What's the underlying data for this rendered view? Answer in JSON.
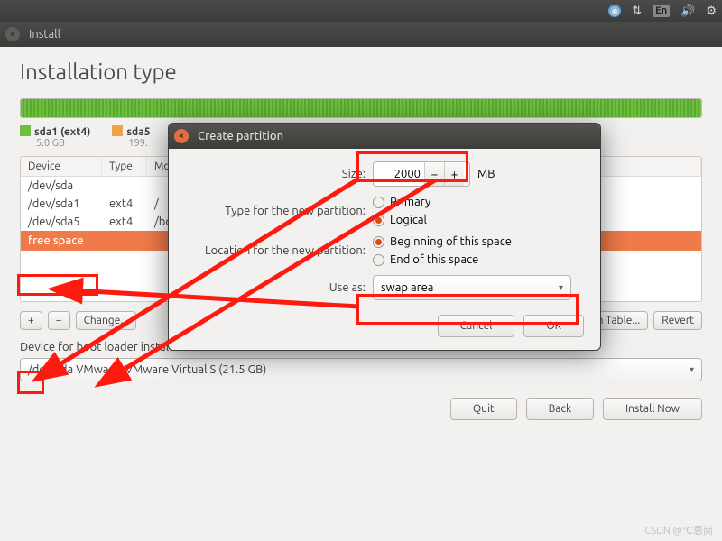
{
  "topbar": {
    "lang": "En"
  },
  "window": {
    "title": "Install",
    "heading": "Installation type",
    "legend": [
      {
        "label": "sda1 (ext4)",
        "size": "5.0 GB",
        "color": "#6fbf3f"
      },
      {
        "label": "sda5",
        "size": "199.",
        "color": "#f0a24a"
      }
    ],
    "columns": {
      "device": "Device",
      "type": "Type",
      "mount": "Mo"
    },
    "rows": [
      {
        "device": "/dev/sda",
        "type": "",
        "mount": ""
      },
      {
        "device": " /dev/sda1",
        "type": "ext4",
        "mount": "/"
      },
      {
        "device": " /dev/sda5",
        "type": "ext4",
        "mount": "/bo"
      },
      {
        "device": " free space",
        "type": "",
        "mount": "",
        "free": true
      }
    ],
    "toolbar": {
      "add": "+",
      "remove": "−",
      "change": "Change...",
      "newtable": "New Partition Table...",
      "revert": "Revert"
    },
    "boot_label": "Device for boot loader installation:",
    "boot_value": "/dev/sda   VMware, VMware Virtual S (21.5 GB)",
    "buttons": {
      "quit": "Quit",
      "back": "Back",
      "install": "Install Now"
    }
  },
  "dialog": {
    "title": "Create partition",
    "size_label": "Size:",
    "size_value": "2000",
    "size_unit": "MB",
    "type_label": "Type for the new partition:",
    "type_options": {
      "primary": "Primary",
      "logical": "Logical"
    },
    "type_selected": "logical",
    "loc_label": "Location for the new partition:",
    "loc_options": {
      "begin": "Beginning of this space",
      "end": "End of this space"
    },
    "loc_selected": "begin",
    "use_label": "Use as:",
    "use_value": "swap area",
    "buttons": {
      "cancel": "Cancel",
      "ok": "OK"
    }
  },
  "watermark": "CSDN @℃恩尚"
}
